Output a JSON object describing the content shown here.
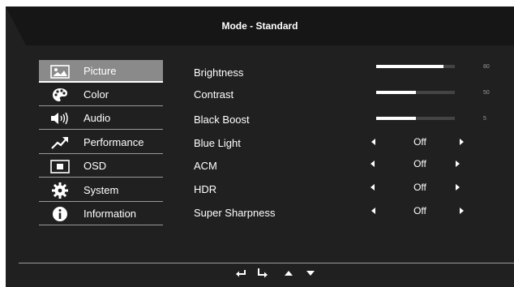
{
  "header": {
    "title": "Mode - Standard"
  },
  "sidebar": {
    "items": [
      {
        "label": "Picture",
        "icon": "picture-icon",
        "selected": true
      },
      {
        "label": "Color",
        "icon": "palette-icon"
      },
      {
        "label": "Audio",
        "icon": "speaker-icon"
      },
      {
        "label": "Performance",
        "icon": "trend-icon"
      },
      {
        "label": "OSD",
        "icon": "screen-icon"
      },
      {
        "label": "System",
        "icon": "gear-icon"
      },
      {
        "label": "Information",
        "icon": "info-icon"
      }
    ]
  },
  "settings": {
    "brightness": {
      "label": "Brightness",
      "value": "80",
      "level": 0.86
    },
    "contrast": {
      "label": "Contrast",
      "value": "50",
      "level": 0.5
    },
    "black_boost": {
      "label": "Black Boost",
      "value": "5",
      "level": 0.5
    },
    "blue_light": {
      "label": "Blue Light",
      "value": "Off"
    },
    "acm": {
      "label": "ACM",
      "value": "Off"
    },
    "hdr": {
      "label": "HDR",
      "value": "Off"
    },
    "super_sharpness": {
      "label": "Super Sharpness",
      "value": "Off"
    }
  },
  "footer": {
    "nav_icons": [
      "return-icon",
      "enter-icon",
      "up-arrow-icon",
      "down-arrow-icon"
    ]
  },
  "colors": {
    "background": "#202020",
    "header": "#161616",
    "selected": "#8a8a8a",
    "text": "#ffffff"
  }
}
